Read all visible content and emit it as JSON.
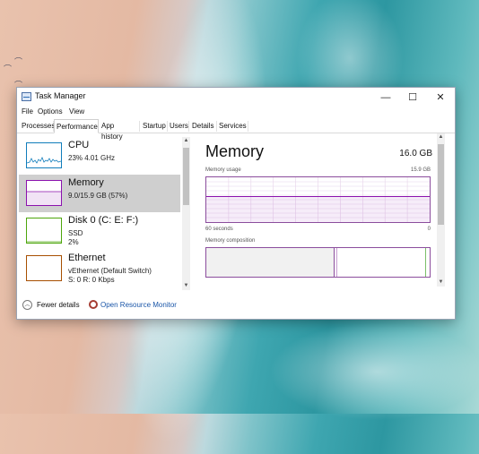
{
  "window": {
    "title": "Task Manager",
    "minimize": "—",
    "maximize": "☐",
    "close": "✕"
  },
  "menu": [
    "File",
    "Options",
    "View"
  ],
  "tabs": [
    "Processes",
    "Performance",
    "App history",
    "Startup",
    "Users",
    "Details",
    "Services"
  ],
  "active_tab": "Performance",
  "sidebar": {
    "items": [
      {
        "title": "CPU",
        "sub1": "23%  4.01 GHz",
        "sub2": "",
        "color": "#117dbb",
        "selected": false
      },
      {
        "title": "Memory",
        "sub1": "9.0/15.9 GB (57%)",
        "sub2": "",
        "color": "#8b12ae",
        "selected": true
      },
      {
        "title": "Disk 0 (C: E: F:)",
        "sub1": "SSD",
        "sub2": "2%",
        "color": "#4da60c",
        "selected": false
      },
      {
        "title": "Ethernet",
        "sub1": "vEthernet (Default Switch)",
        "sub2": "S: 0  R: 0 Kbps",
        "color": "#a74f01",
        "selected": false
      }
    ]
  },
  "main": {
    "title": "Memory",
    "capacity": "16.0 GB",
    "usage_label": "Memory usage",
    "usage_max": "15.9 GB",
    "time_left": "60 seconds",
    "time_right": "0",
    "composition_label": "Memory composition",
    "usage_fraction": 0.57,
    "composition": {
      "in_use": 0.57,
      "modified": 0.01,
      "standby": 0.41,
      "free": 0.01
    }
  },
  "footer": {
    "fewer_details": "Fewer details",
    "open_resmon": "Open Resource Monitor"
  },
  "colors": {
    "memory": "#8b12ae",
    "cpu": "#117dbb",
    "disk": "#4da60c",
    "ethernet": "#a74f01",
    "link": "#1a56a8"
  }
}
